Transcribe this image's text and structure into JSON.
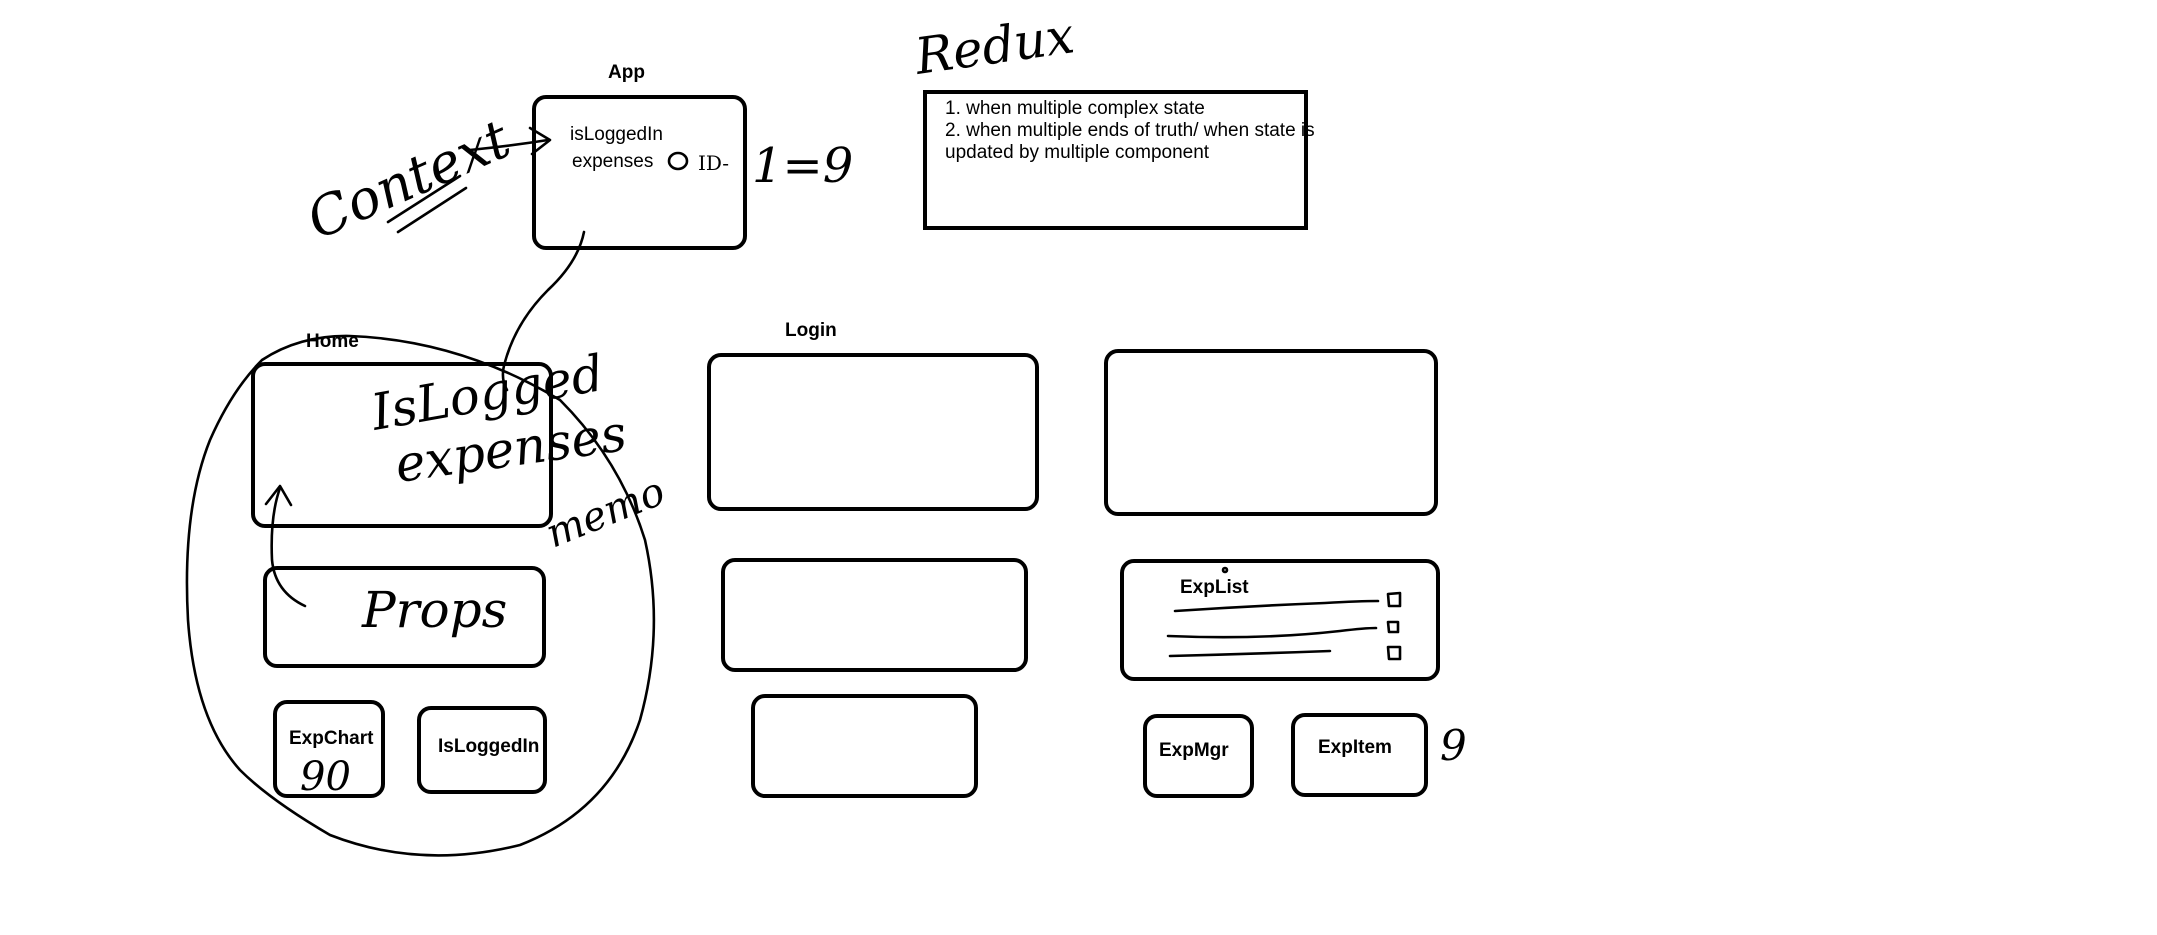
{
  "colors": {
    "ink": "#000000",
    "background": "#ffffff"
  },
  "diagram": {
    "app": {
      "title": "App",
      "state_line1": "isLoggedIn",
      "state_line2": "expenses",
      "id_note": "ID-",
      "id_ratio": "1=9"
    },
    "redux": {
      "title": "Redux",
      "notes": [
        "1. when multiple complex state",
        "2. when multiple ends of truth/ when state is",
        "updated by multiple component"
      ]
    },
    "context_label": "Context",
    "home": {
      "title": "Home",
      "handwritten_line1": "IsLogged",
      "handwritten_line2": "expenses"
    },
    "props_label": "Props",
    "memo_label": "memo",
    "exp_chart": {
      "label": "ExpChart",
      "handwritten": "90"
    },
    "is_logged_in_box": {
      "label": "IsLoggedIn"
    },
    "login": {
      "title": "Login"
    },
    "exp_list": {
      "label": "ExpList"
    },
    "exp_mgr": {
      "label": "ExpMgr"
    },
    "exp_item": {
      "label": "ExpItem",
      "handwritten": "9"
    }
  }
}
